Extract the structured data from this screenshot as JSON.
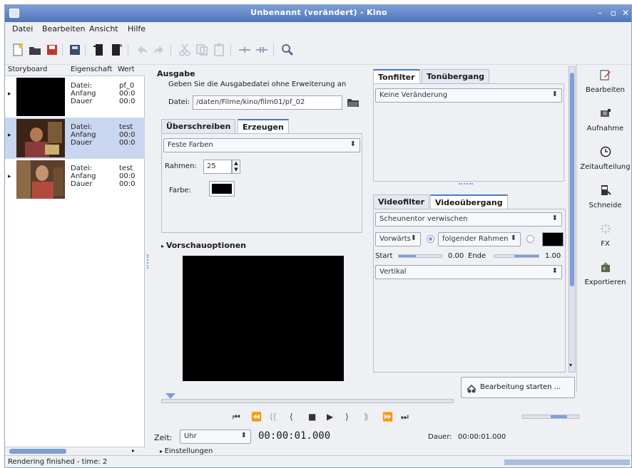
{
  "window": {
    "title": "Unbenannt (verändert) - Kino",
    "controls": [
      "–",
      "▫",
      "✕"
    ]
  },
  "menu": {
    "items": [
      "Datei",
      "Bearbeiten",
      "Ansicht",
      "Hilfe"
    ]
  },
  "storyboard": {
    "headers": [
      "Storyboard",
      "Eigenschaft",
      "Wert"
    ],
    "rows": [
      {
        "labels": [
          "Datei:",
          "Anfang",
          "Dauer"
        ],
        "values": [
          "pf_0",
          "00:0",
          "00:0"
        ]
      },
      {
        "labels": [
          "Datei:",
          "Anfang",
          "Dauer"
        ],
        "values": [
          "test",
          "00:0",
          "00:0"
        ]
      },
      {
        "labels": [
          "Datei:",
          "Anfang",
          "Dauer"
        ],
        "values": [
          "test",
          "00:0",
          "00:0"
        ]
      }
    ]
  },
  "output": {
    "heading": "Ausgabe",
    "description": "Geben Sie die Ausgabedatei ohne Erweiterung an",
    "file_label": "Datei:",
    "file_value": "/daten/Filme/kino/film01/pf_02"
  },
  "generator": {
    "tabs": [
      "Überschreiben",
      "Erzeugen"
    ],
    "type_value": "Feste Farben",
    "frames_label": "Rahmen:",
    "frames_value": "25",
    "color_label": "Farbe:",
    "color": "#000000"
  },
  "preview": {
    "label": "Vorschauoptionen"
  },
  "audio": {
    "tabs": [
      "Tonfilter",
      "Tonübergang"
    ],
    "filter_value": "Keine Veränderung"
  },
  "video": {
    "tabs": [
      "Videofilter",
      "Videoübergang"
    ],
    "transition_value": "Scheunentor verwischen",
    "direction_value": "Vorwärts",
    "frame_value": "folgender Rahmen",
    "start_label": "Start",
    "start_value": "0.00",
    "end_label": "Ende",
    "end_value": "1.00",
    "orientation_value": "Vertikal"
  },
  "sidebar": {
    "items": [
      {
        "label": "Bearbeiten",
        "icon": "edit-icon"
      },
      {
        "label": "Aufnahme",
        "icon": "capture-icon"
      },
      {
        "label": "Zeitaufteilung",
        "icon": "clock-icon"
      },
      {
        "label": "Schneide",
        "icon": "trim-icon"
      },
      {
        "label": "FX",
        "icon": "fx-icon"
      },
      {
        "label": "Exportieren",
        "icon": "export-icon"
      }
    ]
  },
  "process": {
    "button_label": "Bearbeitung starten ..."
  },
  "transport": {
    "buttons": [
      "⏮",
      "⏪",
      "⟨⟨",
      "⟨",
      "■",
      "▶",
      "⟩",
      "⟫",
      "⏩",
      "⏭"
    ]
  },
  "time": {
    "label": "Zeit:",
    "mode": "Uhr",
    "value": "00:00:01.000",
    "duration_label": "Dauer:",
    "duration_value": "00:00:01.000"
  },
  "settings": {
    "label": "Einstellungen"
  },
  "status": {
    "text": "Rendering finished - time: 2"
  }
}
